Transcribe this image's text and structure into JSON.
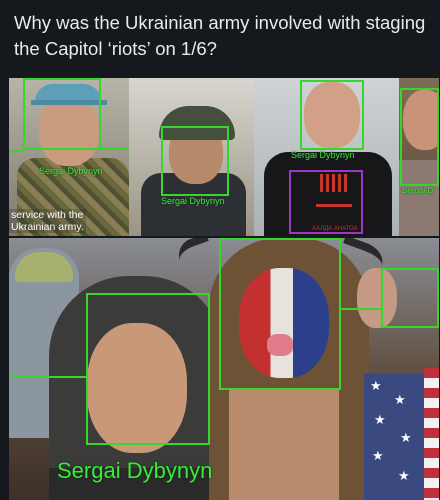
{
  "post": {
    "question": "Why was the Ukrainian army involved with staging the Capitol ‘riots’ on 1/6?"
  },
  "top_image": {
    "caption_lines": [
      "service with the",
      "Ukrainian army."
    ],
    "labels": [
      "Sergai Dybynyn",
      "Sergai Dybynyn",
      "Sergai Dybynyn",
      "Sergai D"
    ],
    "shirt_text": "ХАЛДА АНАТОА"
  },
  "bottom_image": {
    "label": "Sergai Dybynyn"
  }
}
